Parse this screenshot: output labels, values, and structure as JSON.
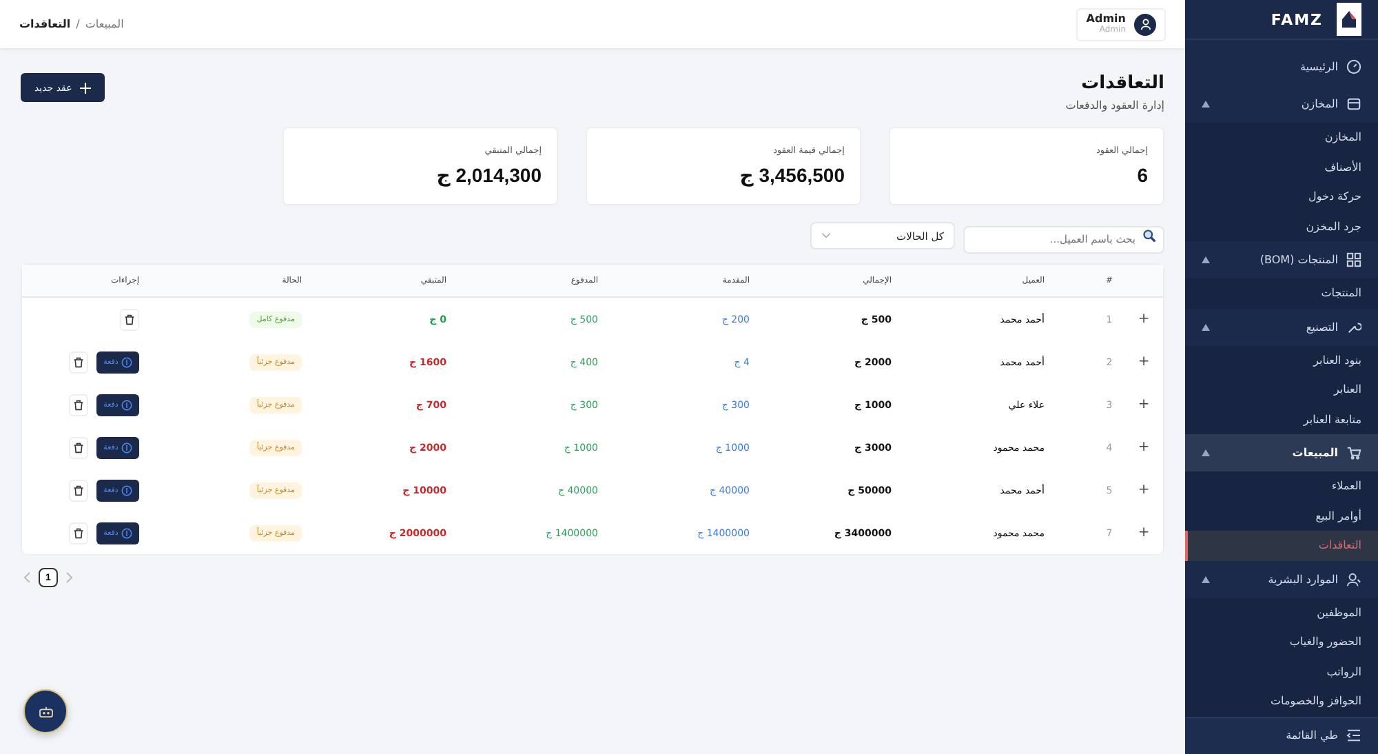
{
  "sidebar": {
    "brand": "FAMZ",
    "items": [
      {
        "label": "الرئيسية",
        "kind": "link",
        "selected": false
      },
      {
        "label": "المخازن",
        "kind": "group",
        "selected": false,
        "expanded": true,
        "children": [
          {
            "label": "المخازن",
            "selected": false
          },
          {
            "label": "الأصناف",
            "selected": false
          },
          {
            "label": "حركة دخول",
            "selected": false
          },
          {
            "label": "جرد المخزن",
            "selected": false
          }
        ]
      },
      {
        "label": "المنتجات (BOM)",
        "kind": "group",
        "selected": false,
        "expanded": true,
        "children": [
          {
            "label": "المنتجات",
            "selected": false
          }
        ]
      },
      {
        "label": "التصنيع",
        "kind": "group",
        "selected": false,
        "expanded": true,
        "children": [
          {
            "label": "بنود العنابر",
            "selected": false
          },
          {
            "label": "العنابر",
            "selected": false
          },
          {
            "label": "متابعة العنابر",
            "selected": false
          }
        ]
      },
      {
        "label": "المبيعات",
        "kind": "group",
        "selected": true,
        "expanded": true,
        "children": [
          {
            "label": "العملاء",
            "selected": false
          },
          {
            "label": "أوامر البيع",
            "selected": false
          },
          {
            "label": "التعاقدات",
            "selected": true
          }
        ]
      },
      {
        "label": "الموارد البشرية",
        "kind": "group",
        "selected": false,
        "expanded": true,
        "children": [
          {
            "label": "الموظفين",
            "selected": false
          },
          {
            "label": "الحضور والغياب",
            "selected": false
          },
          {
            "label": "الرواتب",
            "selected": false
          },
          {
            "label": "الحوافز والخصومات",
            "selected": false
          }
        ]
      }
    ],
    "collapse": "طي القائمة"
  },
  "header": {
    "breadcrumb_parent": "المبيعات",
    "breadcrumb_separator": "/",
    "breadcrumb_current": "التعاقدات",
    "user_name": "Admin",
    "user_role": "Admin"
  },
  "page": {
    "title": "التعاقدات",
    "subtitle": "إدارة العقود والدفعات",
    "new_button": "عقد جديد"
  },
  "stats": [
    {
      "label": "إجمالي العقود",
      "value": "6"
    },
    {
      "label": "إجمالي قيمة العقود",
      "value": "3,456,500 ج"
    },
    {
      "label": "إجمالي المتبقي",
      "value": "2,014,300 ج"
    }
  ],
  "filters": {
    "search_placeholder": "بحث باسم العميل...",
    "status_value": "كل الحالات"
  },
  "table": {
    "columns": [
      "#",
      "العميل",
      "الإجمالي",
      "المقدمة",
      "المدفوع",
      "المتبقي",
      "الحالة",
      "إجراءات"
    ],
    "rows": [
      {
        "expand": "+",
        "number": "1",
        "client": "أحمد محمد",
        "total": "500 ج",
        "advance": "200 ج",
        "paid": "500 ج",
        "remaining": "0 ج",
        "status": "مدفوع كامل",
        "kind": "full"
      },
      {
        "expand": "+",
        "number": "2",
        "client": "أحمد محمد",
        "total": "2000 ج",
        "advance": "4 ج",
        "paid": "400 ج",
        "remaining": "1600 ج",
        "status": "مدفوع جزئياً",
        "kind": "partial",
        "pay_button": "دفعة"
      },
      {
        "expand": "+",
        "number": "3",
        "client": "علاء علي",
        "total": "1000 ج",
        "advance": "300 ج",
        "paid": "300 ج",
        "remaining": "700 ج",
        "status": "مدفوع جزئياً",
        "kind": "partial",
        "pay_button": "دفعة"
      },
      {
        "expand": "+",
        "number": "4",
        "client": "محمد محمود",
        "total": "3000 ج",
        "advance": "1000 ج",
        "paid": "1000 ج",
        "remaining": "2000 ج",
        "status": "مدفوع جزئياً",
        "kind": "partial",
        "pay_button": "دفعة"
      },
      {
        "expand": "+",
        "number": "5",
        "client": "أحمد محمد",
        "total": "50000 ج",
        "advance": "40000 ج",
        "paid": "40000 ج",
        "remaining": "10000 ج",
        "status": "مدفوع جزئياً",
        "kind": "partial",
        "pay_button": "دفعة"
      },
      {
        "expand": "+",
        "number": "7",
        "client": "محمد محمود",
        "total": "3400000 ج",
        "advance": "1400000 ج",
        "paid": "1400000 ج",
        "remaining": "2000000 ج",
        "status": "مدفوع جزئياً",
        "kind": "partial",
        "pay_button": "دفعة"
      }
    ]
  },
  "pagination": {
    "pages": [
      {
        "label": "1",
        "selected": true
      }
    ]
  }
}
